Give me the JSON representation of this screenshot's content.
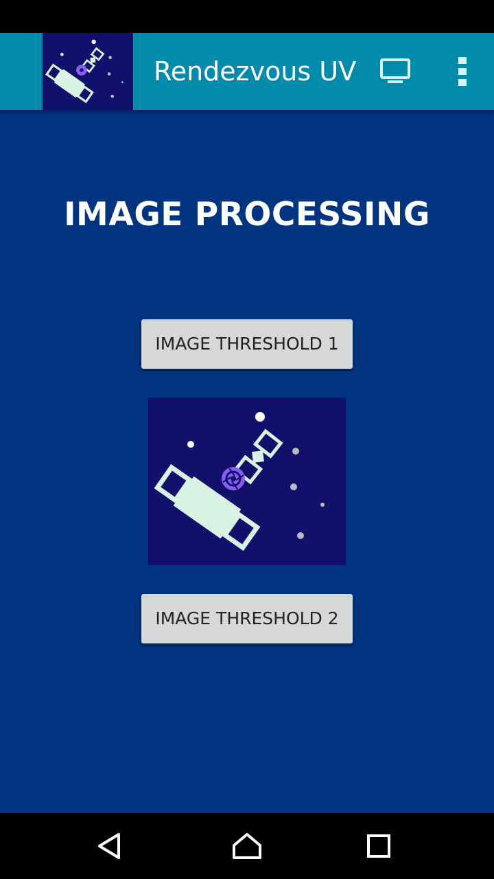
{
  "app_bar": {
    "title": "Rendezvous UV",
    "background_color": "#008bab",
    "logo_icon": "satellite-logo-icon",
    "actions": [
      {
        "icon": "cast-screen-icon"
      },
      {
        "icon": "overflow-menu-icon"
      }
    ]
  },
  "main": {
    "background_color": "#003380",
    "heading": "IMAGE PROCESSING",
    "button_1_label": "IMAGE THRESHOLD 1",
    "button_2_label": "IMAGE THRESHOLD 2",
    "illustration_icon": "satellites-illustration"
  },
  "nav_bar": {
    "back_icon": "back-triangle-icon",
    "home_icon": "home-icon",
    "recents_icon": "recents-square-icon"
  }
}
